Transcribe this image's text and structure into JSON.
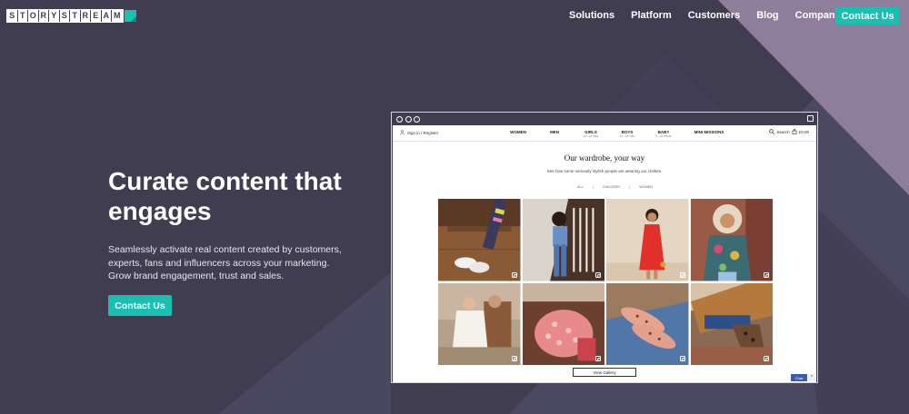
{
  "brand": {
    "logo_letters": [
      "S",
      "T",
      "O",
      "R",
      "Y",
      "S",
      "T",
      "R",
      "E",
      "A",
      "M"
    ],
    "accent": "#1bbfb0",
    "background": "#3f3d4f"
  },
  "nav": {
    "items": [
      {
        "label": "Solutions"
      },
      {
        "label": "Platform"
      },
      {
        "label": "Customers"
      },
      {
        "label": "Blog"
      },
      {
        "label": "Company"
      }
    ],
    "cta_label": "Contact Us"
  },
  "hero": {
    "title": "Curate content that engages",
    "subtitle": "Seamlessly activate real content created by customers, experts, fans and influencers across your marketing. Grow brand engagement, trust and sales.",
    "cta_label": "Contact Us"
  },
  "mock_site": {
    "signin": "Sign in / Register",
    "categories": [
      {
        "label": "WOMEN",
        "sub": ""
      },
      {
        "label": "MEN",
        "sub": ""
      },
      {
        "label": "GIRLS",
        "sub": "2Y - 16 YRS"
      },
      {
        "label": "BOYS",
        "sub": "2Y - 16 YRS"
      },
      {
        "label": "BABY",
        "sub": "0 - 24 MTHS"
      },
      {
        "label": "MINI MISSIONS",
        "sub": ""
      }
    ],
    "search_label": "Search",
    "basket": "£0.00",
    "heading": "Our wardrobe, your way",
    "description": "See how some seriously stylish people are wearing our clothes.",
    "filters": [
      "ALL",
      "CHILDREN",
      "WOMEN"
    ],
    "view_gallery": "View Gallery",
    "chat_label": "Chat",
    "scroll_top": "^"
  },
  "gallery": {
    "tiles": [
      {
        "name": "wooden-floor-shoes-photo"
      },
      {
        "name": "staircase-denim-photo"
      },
      {
        "name": "red-dress-girl-photo"
      },
      {
        "name": "hooded-jacket-girl-photo"
      },
      {
        "name": "christening-gown-photo"
      },
      {
        "name": "pink-floral-dress-photo"
      },
      {
        "name": "leopard-slippers-photo"
      },
      {
        "name": "leopard-boots-photo"
      }
    ]
  }
}
